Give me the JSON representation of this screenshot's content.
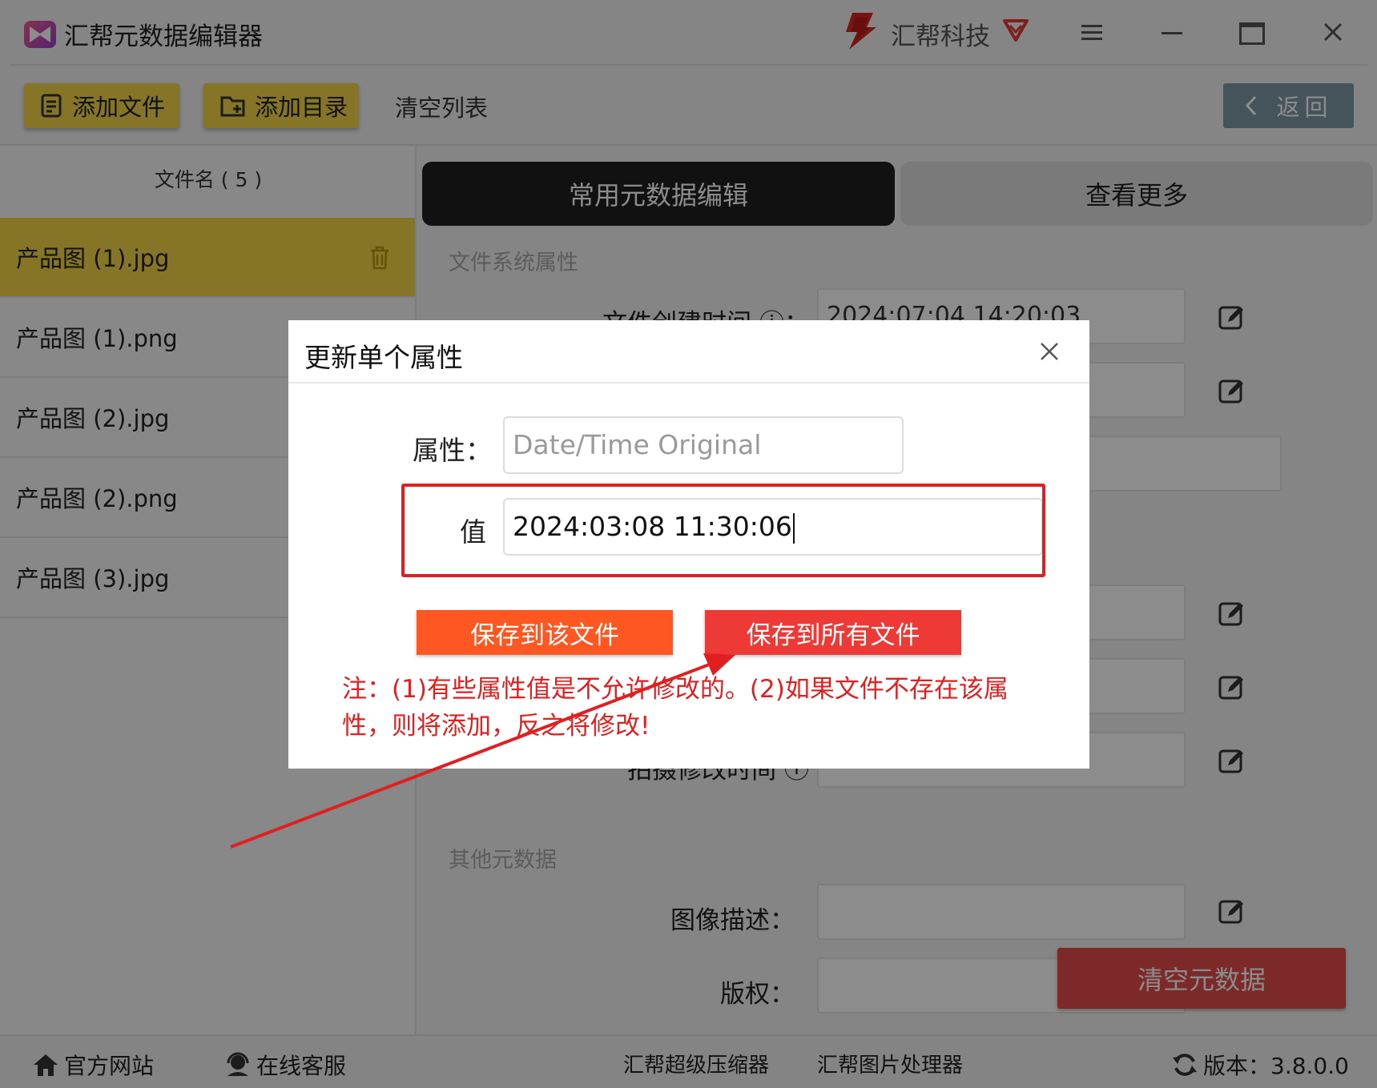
{
  "app": {
    "title": "汇帮元数据编辑器",
    "brand": "汇帮科技"
  },
  "toolbar": {
    "add_file": "添加文件",
    "add_dir": "添加目录",
    "clear_list": "清空列表",
    "back": "返回"
  },
  "file_list": {
    "header": "文件名 ( 5 )",
    "files": [
      "产品图 (1).jpg",
      "产品图 (1).png",
      "产品图 (2).jpg",
      "产品图 (2).png",
      "产品图 (3).jpg"
    ],
    "selected_index": 0
  },
  "tabs": {
    "common": "常用元数据编辑",
    "more": "查看更多"
  },
  "sections": {
    "fs_props": "文件系统属性",
    "other_meta": "其他元数据"
  },
  "fields": {
    "create_time_label": "文件创建时间 ⓘ：",
    "create_time_value": "2024:07:04 14:20:03",
    "modify_label": "拍摄修改时间 ⓘ",
    "image_desc_label": "图像描述：",
    "copyright_label": "版权："
  },
  "clear_meta_button": "清空元数据",
  "status": {
    "website": "官方网站",
    "support": "在线客服",
    "compressor": "汇帮超级压缩器",
    "image_tool": "汇帮图片处理器",
    "version": "版本：3.8.0.0"
  },
  "modal": {
    "title": "更新单个属性",
    "attr_label": "属性：",
    "attr_placeholder": "Date/Time Original",
    "value_label": "值",
    "value": "2024:03:08 11:30:06",
    "save_this": "保存到该文件",
    "save_all": "保存到所有文件",
    "note": "注：(1)有些属性值是不允许修改的。(2)如果文件不存在该属性，则将添加，反之将修改!"
  },
  "colors": {
    "accent_yellow": "#f5d447",
    "save_this": "#ff5722",
    "save_all": "#ee3a36",
    "highlight_red": "#e02020",
    "back_button": "#7f97a4"
  }
}
